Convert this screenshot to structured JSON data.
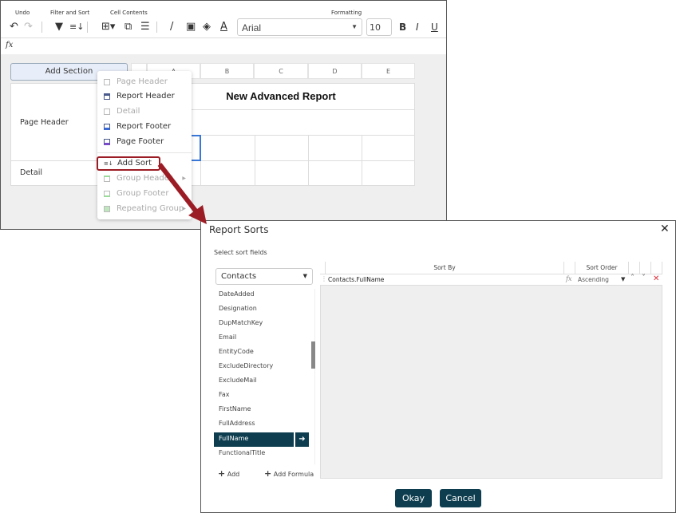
{
  "toolbar": {
    "groups": [
      "Undo",
      "Filter and Sort",
      "Cell Contents",
      "Formatting"
    ],
    "font": "Arial",
    "font_size": "10",
    "bold": "B",
    "italic": "I",
    "underline": "U",
    "fx": "fx"
  },
  "columns": [
    "A",
    "B",
    "C",
    "D",
    "E"
  ],
  "add_section": "Add Section",
  "report": {
    "title": "New Advanced Report",
    "sections": [
      "Page Header",
      "Detail"
    ]
  },
  "menu": [
    {
      "label": "Page Header",
      "enabled": false
    },
    {
      "label": "Report Header",
      "enabled": true
    },
    {
      "label": "Detail",
      "enabled": false
    },
    {
      "label": "Report Footer",
      "enabled": true
    },
    {
      "label": "Page Footer",
      "enabled": true
    },
    {
      "label": "Add Sort",
      "enabled": true,
      "highlighted": true
    },
    {
      "label": "Group Header",
      "enabled": false,
      "submenu": true
    },
    {
      "label": "Group Footer",
      "enabled": false
    },
    {
      "label": "Repeating Group",
      "enabled": false,
      "submenu": true
    }
  ],
  "dialog": {
    "title": "Report Sorts",
    "subtitle": "Select sort fields",
    "source": "Contacts",
    "fields": [
      "DateAdded",
      "Designation",
      "DupMatchKey",
      "Email",
      "EntityCode",
      "ExcludeDirectory",
      "ExcludeMail",
      "Fax",
      "FirstName",
      "FullAddress",
      "FullName",
      "FunctionalTitle"
    ],
    "selected_field": "FullName",
    "add": "Add",
    "add_formula": "Add Formula",
    "headers": {
      "sort_by": "Sort By",
      "sort_order": "Sort Order"
    },
    "rows": [
      {
        "field": "Contacts.FullName",
        "order": "Ascending"
      }
    ],
    "okay": "Okay",
    "cancel": "Cancel"
  },
  "colors": {
    "accent": "#0d3d4f",
    "arrow": "#9b1c24",
    "delete": "#e0303a"
  }
}
